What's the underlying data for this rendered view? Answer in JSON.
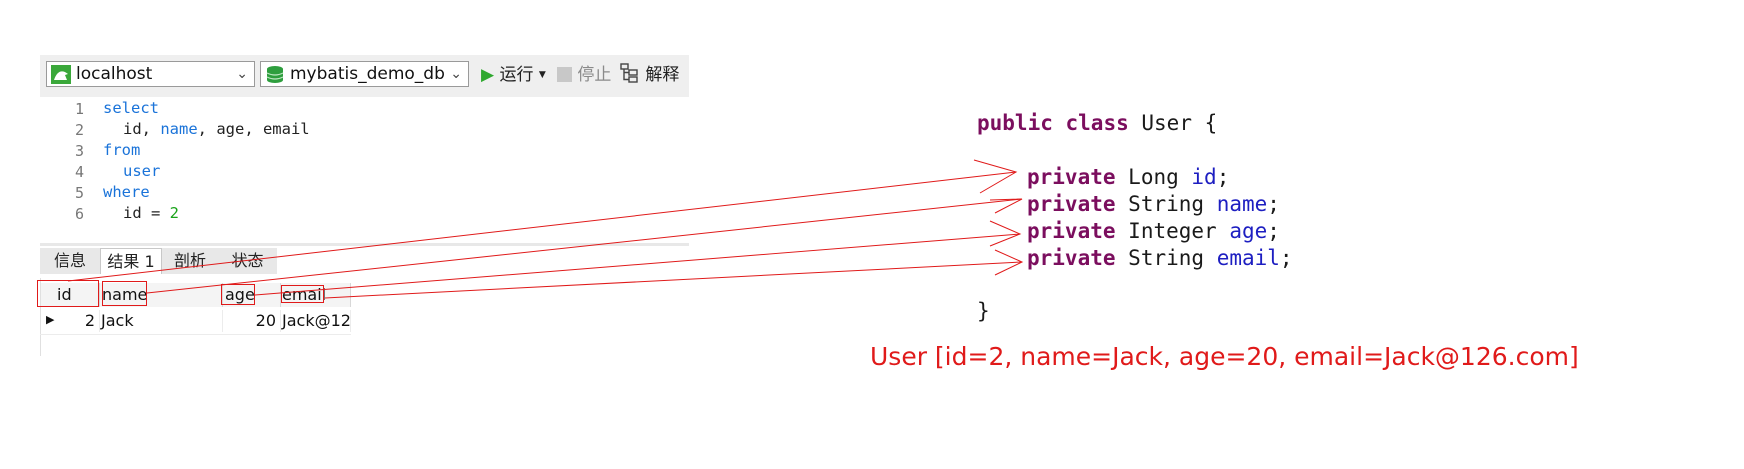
{
  "toolbar": {
    "connection": "localhost",
    "database": "mybatis_demo_db",
    "run_label": "运行",
    "stop_label": "停止",
    "explain_label": "解释"
  },
  "editor": {
    "line_numbers": [
      "1",
      "2",
      "3",
      "4",
      "5",
      "6"
    ],
    "lines": [
      {
        "kw": "select"
      },
      {
        "a": "id, ",
        "b": "name",
        "c": ", age, email"
      },
      {
        "kw": "from"
      },
      {
        "kw": "user"
      },
      {
        "kw": "where"
      },
      {
        "a": "id = ",
        "num": "2"
      }
    ]
  },
  "result_tabs": [
    "信息",
    "结果 1",
    "剖析",
    "状态"
  ],
  "grid": {
    "columns": [
      "id",
      "name",
      "age",
      "email"
    ],
    "rows": [
      {
        "id": "2",
        "name": "Jack",
        "age": "20",
        "email": "Jack@12"
      }
    ]
  },
  "java": {
    "class_decl": {
      "kw1": "public",
      "kw2": "class",
      "name": "User {"
    },
    "fields": [
      {
        "kw": "private",
        "type": "Long",
        "name": "id"
      },
      {
        "kw": "private",
        "type": "String",
        "name": "name"
      },
      {
        "kw": "private",
        "type": "Integer",
        "name": "age"
      },
      {
        "kw": "private",
        "type": "String",
        "name": "email"
      }
    ],
    "close": "}"
  },
  "tostring_output": "User [id=2, name=Jack, age=20, email=Jack@126.com]",
  "colors": {
    "annotation": "#e01a1a",
    "sql_keyword": "#1a73d9",
    "java_keyword": "#7b0e5e",
    "java_field": "#1d1ec1"
  }
}
